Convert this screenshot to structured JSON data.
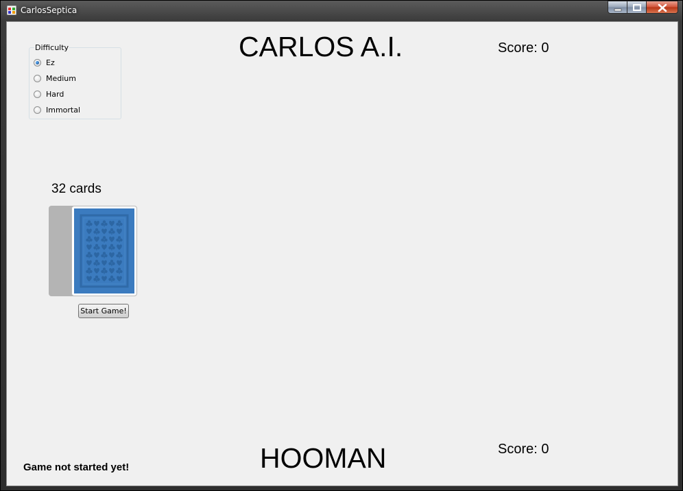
{
  "window": {
    "title": "CarlosSeptica"
  },
  "difficulty": {
    "legend": "Difficulty",
    "options": [
      "Ez",
      "Medium",
      "Hard",
      "Immortal"
    ],
    "selected": "Ez"
  },
  "ai": {
    "name": "CARLOS A.I.",
    "score": "Score: 0"
  },
  "human": {
    "name": "HOOMAN",
    "score": "Score: 0"
  },
  "deck": {
    "count_label": "32 cards"
  },
  "controls": {
    "start_label": "Start Game!"
  },
  "status": {
    "message": "Game not started yet!"
  },
  "colors": {
    "card_back": "#3b7bbf",
    "window_bg": "#f0f0f0"
  }
}
